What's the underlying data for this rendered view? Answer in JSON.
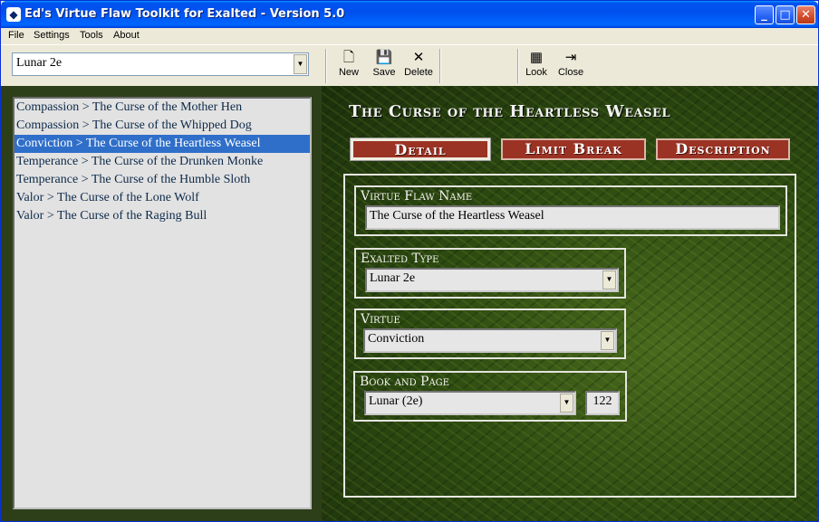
{
  "window": {
    "title": "Ed's Virtue Flaw Toolkit for Exalted - Version 5.0"
  },
  "menu": [
    "File",
    "Settings",
    "Tools",
    "About"
  ],
  "toolbar": {
    "type_select": "Lunar 2e",
    "new_label": "New",
    "save_label": "Save",
    "delete_label": "Delete",
    "look_label": "Look",
    "close_label": "Close"
  },
  "flaw_list": [
    "Compassion > The Curse of the Mother Hen",
    "Compassion > The Curse of the Whipped Dog",
    "Conviction > The Curse of the Heartless Weasel",
    "Temperance > The Curse of the Drunken Monke",
    "Temperance > The Curse of the Humble Sloth",
    "Valor > The Curse of the Lone Wolf",
    "Valor > The Curse of the Raging Bull"
  ],
  "selected_index": 2,
  "detail": {
    "heading": "The Curse of the Heartless Weasel",
    "tabs": [
      "Detail",
      "Limit Break",
      "Description"
    ],
    "active_tab": "Detail",
    "name_label": "Virtue Flaw Name",
    "name_value": "The Curse of the Heartless Weasel",
    "type_label": "Exalted Type",
    "type_value": "Lunar 2e",
    "virtue_label": "Virtue",
    "virtue_value": "Conviction",
    "book_label": "Book and Page",
    "book_value": "Lunar (2e)",
    "page_value": "122"
  },
  "icons": {
    "app": "app-icon",
    "new": "new-file-icon",
    "save": "floppy-disk-icon",
    "delete": "x-icon",
    "look": "look-icon",
    "close": "exit-door-icon"
  }
}
